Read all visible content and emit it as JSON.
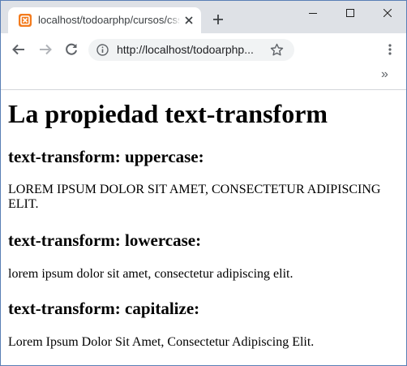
{
  "browser": {
    "tab_title": "localhost/todoarphp/cursos/css/c",
    "url": "http://localhost/todoarphp..."
  },
  "page": {
    "title": "La propiedad text-transform",
    "sections": [
      {
        "heading": "text-transform: uppercase:",
        "text": "LOREM IPSUM DOLOR SIT AMET, CONSECTETUR ADIPISCING ELIT."
      },
      {
        "heading": "text-transform: lowercase:",
        "text": "lorem ipsum dolor sit amet, consectetur adipiscing elit."
      },
      {
        "heading": "text-transform: capitalize:",
        "text": "Lorem Ipsum Dolor Sit Amet, Consectetur Adipiscing Elit."
      }
    ]
  },
  "colors": {
    "titlebar": "#dee1e6",
    "favicon": "#f37b1d",
    "omnibox": "#f1f3f4",
    "window_border": "#5a7fb5"
  },
  "icons": [
    "favicon-icon",
    "close-icon",
    "plus-icon",
    "minimize-icon",
    "maximize-icon",
    "window-close-icon",
    "back-arrow-icon",
    "forward-arrow-icon",
    "reload-icon",
    "info-icon",
    "star-icon",
    "more-vert-icon",
    "chevron-double-right-icon"
  ]
}
